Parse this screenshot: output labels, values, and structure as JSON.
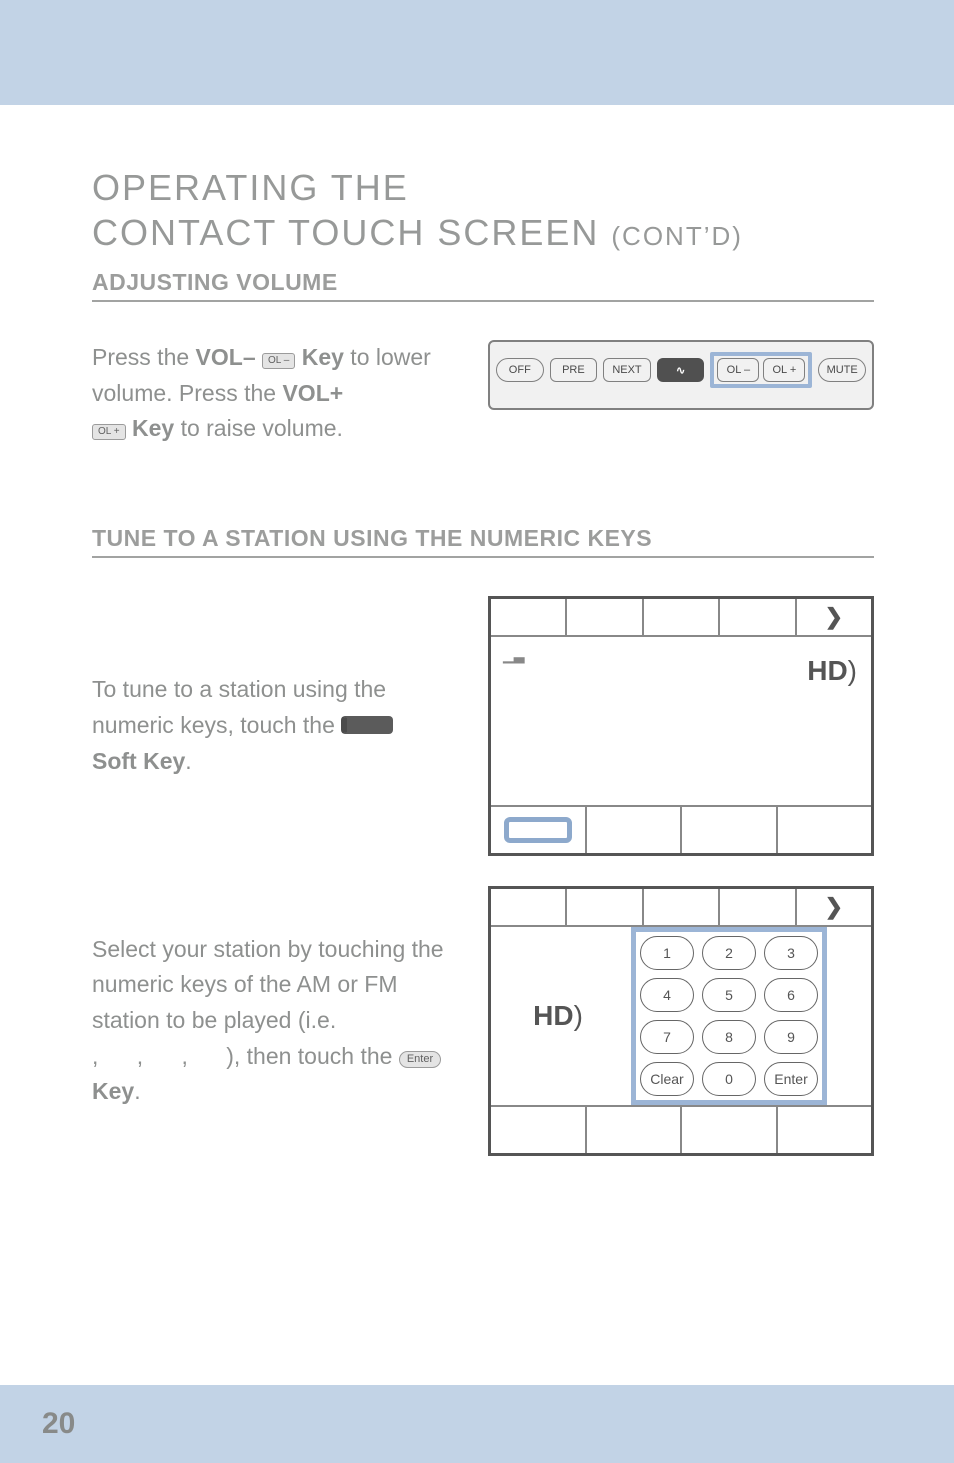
{
  "header": {
    "line1": "OPERATING THE",
    "line2": "CONTACT TOUCH SCREEN ",
    "cont": "(CONT’D)"
  },
  "section1": {
    "title": "ADJUSTING VOLUME",
    "text": {
      "pre": "Press the ",
      "volminus": "VOL– ",
      "olminus_key": "OL –",
      "key1": "Key",
      "mid": " to lower volume. Press the ",
      "volplus": "VOL+",
      "olplus_key": "OL +",
      "key2": "Key",
      "post": " to raise volume."
    },
    "buttons": {
      "off": "OFF",
      "pre": "PRE",
      "next": "NEXT",
      "olminus": "OL –",
      "olplus": "OL +",
      "mute": "MUTE"
    }
  },
  "section2": {
    "title": "TUNE TO A STATION USING THE NUMERIC KEYS",
    "text1": {
      "a": "To tune to a station using the numeric keys, touch the ",
      "b": "Soft Key",
      "c": "."
    },
    "text2": {
      "a": "Select your station by touching the numeric keys of the AM or FM station to be played (i.e.",
      "b": ",      ,      ,      ), then touch the ",
      "enter_key": "Enter",
      "key": "Key",
      "c": "."
    },
    "screen1": {
      "arrow": "❯",
      "hd": "HD",
      "hd_paren": ")"
    },
    "keypad": {
      "k1": "1",
      "k2": "2",
      "k3": "3",
      "k4": "4",
      "k5": "5",
      "k6": "6",
      "k7": "7",
      "k8": "8",
      "k9": "9",
      "clear": "Clear",
      "k0": "0",
      "enter": "Enter"
    }
  },
  "page_number": "20"
}
